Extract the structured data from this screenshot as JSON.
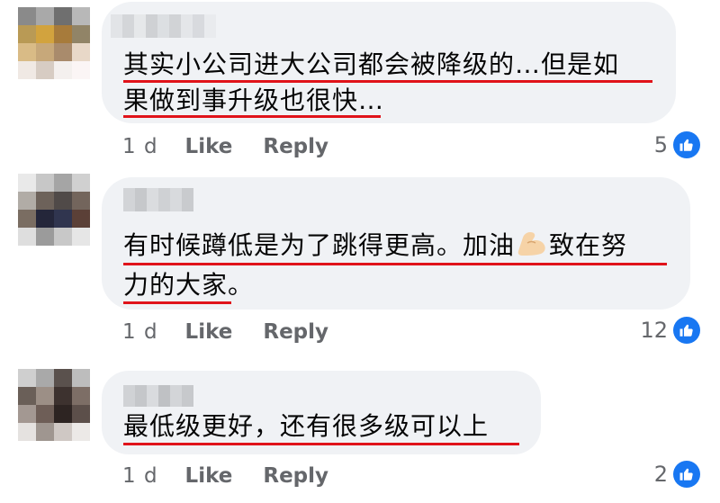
{
  "comments": [
    {
      "lines": [
        "其实小公司进大公司都会被降级的…但是如",
        "果做到事升级也很快…"
      ],
      "time": "1 d",
      "like_label": "Like",
      "reply_label": "Reply",
      "reaction_count": "5"
    },
    {
      "lines": [
        "有时候蹲低是为了跳得更高。加油",
        "致在努",
        "力的大家。"
      ],
      "time": "1 d",
      "like_label": "Like",
      "reply_label": "Reply",
      "reaction_count": "12",
      "emoji": "flexed-biceps-icon"
    },
    {
      "lines": [
        "最低级更好，还有很多级可以上"
      ],
      "time": "1 d",
      "like_label": "Like",
      "reply_label": "Reply",
      "reaction_count": "2"
    }
  ],
  "colors": {
    "bubble": "#f0f2f5",
    "underline": "#e0131a",
    "like_blue": "#1877f2",
    "meta_text": "#65676b"
  }
}
